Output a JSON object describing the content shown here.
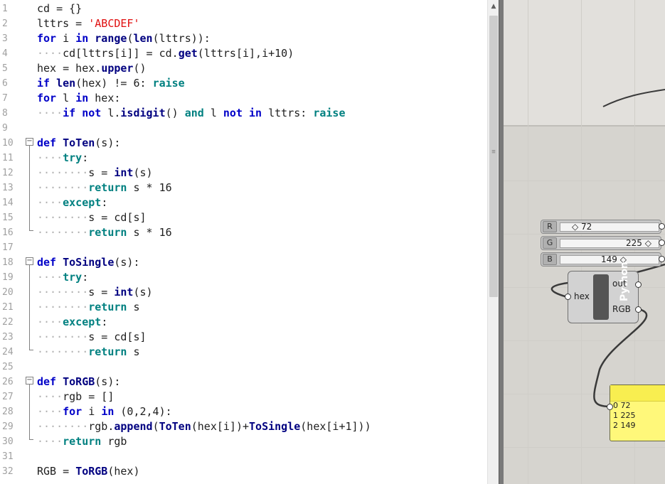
{
  "editor": {
    "line_numbers": [
      "1",
      "2",
      "3",
      "4",
      "5",
      "6",
      "7",
      "8",
      "9",
      "10",
      "11",
      "12",
      "13",
      "14",
      "15",
      "16",
      "17",
      "18",
      "19",
      "20",
      "21",
      "22",
      "23",
      "24",
      "25",
      "26",
      "27",
      "28",
      "29",
      "30",
      "31",
      "32"
    ],
    "lines": [
      [
        [
          "",
          "cd = {}"
        ]
      ],
      [
        [
          "",
          "lttrs = "
        ],
        [
          "str",
          "'ABCDEF'"
        ]
      ],
      [
        [
          "kw",
          "for"
        ],
        [
          "",
          " i "
        ],
        [
          "kw",
          "in"
        ],
        [
          "",
          " "
        ],
        [
          "fn",
          "range"
        ],
        [
          "",
          "("
        ],
        [
          "fn",
          "len"
        ],
        [
          "",
          "(lttrs)):"
        ]
      ],
      [
        [
          "ind",
          "····"
        ],
        [
          "",
          "cd[lttrs[i]] = cd."
        ],
        [
          "fn",
          "get"
        ],
        [
          "",
          "(lttrs[i],i+10)"
        ]
      ],
      [
        [
          "",
          "hex = hex."
        ],
        [
          "fn",
          "upper"
        ],
        [
          "",
          "()"
        ]
      ],
      [
        [
          "kw",
          "if"
        ],
        [
          "",
          " "
        ],
        [
          "fn",
          "len"
        ],
        [
          "",
          "(hex) != 6: "
        ],
        [
          "kw2",
          "raise"
        ]
      ],
      [
        [
          "kw",
          "for"
        ],
        [
          "",
          " l "
        ],
        [
          "kw",
          "in"
        ],
        [
          "",
          " hex:"
        ]
      ],
      [
        [
          "ind",
          "····"
        ],
        [
          "kw",
          "if"
        ],
        [
          "",
          " "
        ],
        [
          "kw",
          "not"
        ],
        [
          "",
          " l."
        ],
        [
          "fn",
          "isdigit"
        ],
        [
          "",
          "() "
        ],
        [
          "kw2",
          "and"
        ],
        [
          "",
          " l "
        ],
        [
          "kw",
          "not"
        ],
        [
          "",
          " "
        ],
        [
          "kw",
          "in"
        ],
        [
          "",
          " lttrs: "
        ],
        [
          "kw2",
          "raise"
        ]
      ],
      [
        [
          "",
          ""
        ]
      ],
      [
        [
          "kw",
          "def"
        ],
        [
          "",
          " "
        ],
        [
          "fn",
          "ToTen"
        ],
        [
          "",
          "(s):"
        ]
      ],
      [
        [
          "ind",
          "····"
        ],
        [
          "kw2",
          "try"
        ],
        [
          "",
          ":"
        ]
      ],
      [
        [
          "ind",
          "········"
        ],
        [
          "",
          "s = "
        ],
        [
          "fn",
          "int"
        ],
        [
          "",
          "(s)"
        ]
      ],
      [
        [
          "ind",
          "········"
        ],
        [
          "kw2",
          "return"
        ],
        [
          "",
          " s * 16"
        ]
      ],
      [
        [
          "ind",
          "····"
        ],
        [
          "kw2",
          "except"
        ],
        [
          "",
          ":"
        ]
      ],
      [
        [
          "ind",
          "········"
        ],
        [
          "",
          "s = cd[s]"
        ]
      ],
      [
        [
          "ind",
          "········"
        ],
        [
          "kw2",
          "return"
        ],
        [
          "",
          " s * 16"
        ]
      ],
      [
        [
          "",
          ""
        ]
      ],
      [
        [
          "kw",
          "def"
        ],
        [
          "",
          " "
        ],
        [
          "fn",
          "ToSingle"
        ],
        [
          "",
          "(s):"
        ]
      ],
      [
        [
          "ind",
          "····"
        ],
        [
          "kw2",
          "try"
        ],
        [
          "",
          ":"
        ]
      ],
      [
        [
          "ind",
          "········"
        ],
        [
          "",
          "s = "
        ],
        [
          "fn",
          "int"
        ],
        [
          "",
          "(s)"
        ]
      ],
      [
        [
          "ind",
          "········"
        ],
        [
          "kw2",
          "return"
        ],
        [
          "",
          " s"
        ]
      ],
      [
        [
          "ind",
          "····"
        ],
        [
          "kw2",
          "except"
        ],
        [
          "",
          ":"
        ]
      ],
      [
        [
          "ind",
          "········"
        ],
        [
          "",
          "s = cd[s]"
        ]
      ],
      [
        [
          "ind",
          "········"
        ],
        [
          "kw2",
          "return"
        ],
        [
          "",
          " s"
        ]
      ],
      [
        [
          "",
          ""
        ]
      ],
      [
        [
          "kw",
          "def"
        ],
        [
          "",
          " "
        ],
        [
          "fn",
          "ToRGB"
        ],
        [
          "",
          "(s):"
        ]
      ],
      [
        [
          "ind",
          "····"
        ],
        [
          "",
          "rgb = []"
        ]
      ],
      [
        [
          "ind",
          "····"
        ],
        [
          "kw",
          "for"
        ],
        [
          "",
          " i "
        ],
        [
          "kw",
          "in"
        ],
        [
          "",
          " (0,2,4):"
        ]
      ],
      [
        [
          "ind",
          "········"
        ],
        [
          "",
          "rgb."
        ],
        [
          "fn",
          "append"
        ],
        [
          "",
          "("
        ],
        [
          "fn",
          "ToTen"
        ],
        [
          "",
          "(hex[i])+"
        ],
        [
          "fn",
          "ToSingle"
        ],
        [
          "",
          "(hex[i+1]))"
        ]
      ],
      [
        [
          "ind",
          "····"
        ],
        [
          "kw2",
          "return"
        ],
        [
          "",
          " rgb"
        ]
      ],
      [
        [
          "",
          ""
        ]
      ],
      [
        [
          "",
          "RGB = "
        ],
        [
          "fn",
          "ToRGB"
        ],
        [
          "",
          "(hex)"
        ]
      ]
    ]
  },
  "sliders": [
    {
      "label": "R",
      "value": "72",
      "value_text": "◇ 72",
      "fraction": 0.28
    },
    {
      "label": "G",
      "value": "225",
      "value_text": "225 ◇",
      "fraction": 0.88
    },
    {
      "label": "B",
      "value": "149",
      "value_text": "149 ◇",
      "fraction": 0.58
    }
  ],
  "python_component": {
    "title": "Python",
    "input": "hex",
    "outputs": [
      "out",
      "RGB"
    ]
  },
  "panel": {
    "rows": [
      [
        "0",
        "72"
      ],
      [
        "1",
        "225"
      ],
      [
        "2",
        "149"
      ]
    ]
  },
  "icons": {
    "scroll_up": "▲",
    "scroll_grip": "≡",
    "fold_open": "−"
  },
  "colors": {
    "keyword": "#0000c8",
    "keyword2": "#008080",
    "function": "#000080",
    "string": "#e01010",
    "panel_bg": "#fff87a",
    "canvas_bg": "#d6d4cf"
  }
}
